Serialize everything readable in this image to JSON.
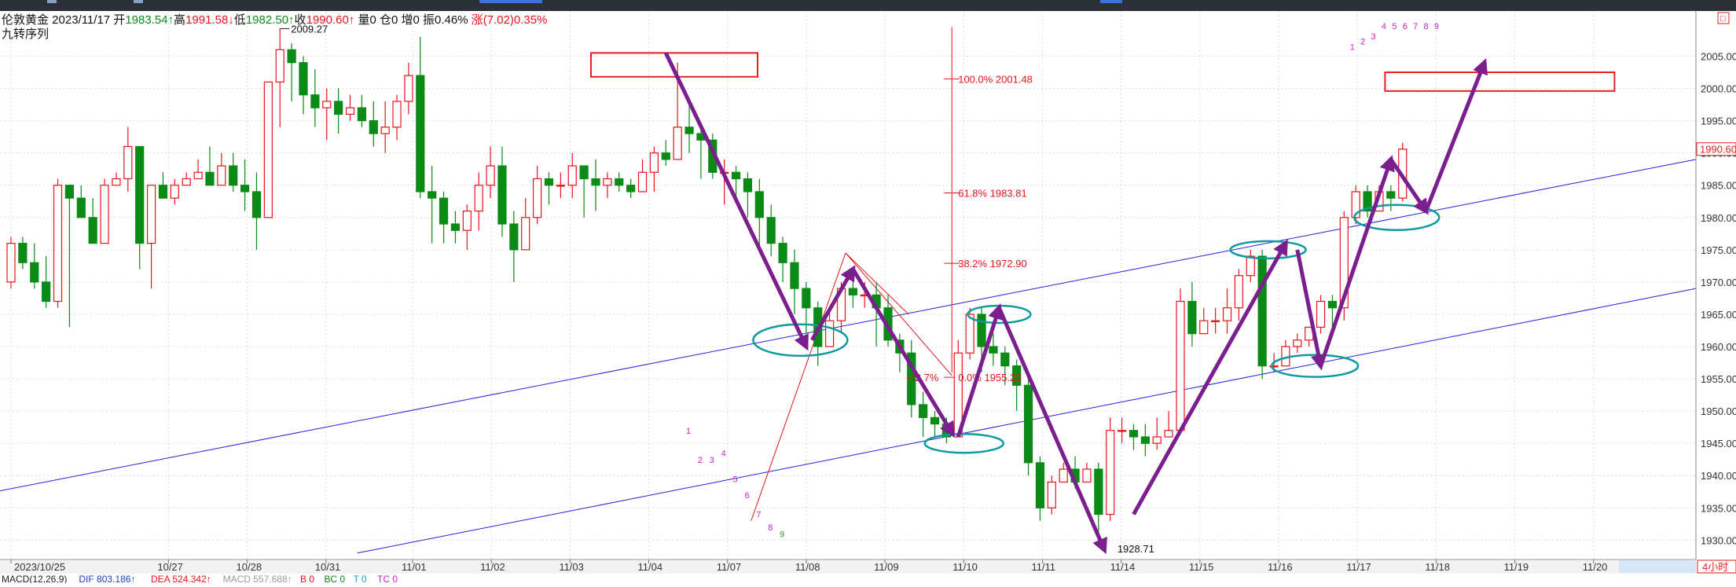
{
  "header": {
    "symbol": "伦敦黄金",
    "date": "2023/11/17",
    "open_label": "开",
    "open": "1983.54",
    "high_label": "高",
    "high": "1991.58",
    "low_label": "低",
    "low": "1982.50",
    "close_label": "收",
    "close": "1990.60",
    "volume": "量0",
    "position": "仓0",
    "increase": "增0",
    "amplitude": "振0.46%",
    "change": "涨(7.02)0.35%",
    "indicator_name": "九转序列"
  },
  "timeframe": "4小时",
  "corner_button": "□",
  "macd_bar": {
    "name": "MACD(12,26,9)",
    "dif": "DIF 803.186↑",
    "dea": "DEA 524.342↑",
    "macd": "MACD 557.688↑",
    "b": "B 0",
    "bc": "BC 0",
    "t": "T 0",
    "tc": "TC 0"
  },
  "colors": {
    "up": "#e8141c",
    "down": "#0b8a16",
    "channel": "#2222dd",
    "arrow": "#7b1f8f",
    "ellipse": "#0d9aa0",
    "box": "#e62020",
    "seq": "#cc22cc",
    "seq_green": "#22aa22"
  },
  "chart_data": {
    "type": "candlestick",
    "ylim": [
      1927,
      2012
    ],
    "y_ticks": [
      "1930.00",
      "1935.00",
      "1940.00",
      "1945.00",
      "1950.00",
      "1955.00",
      "1960.00",
      "1965.00",
      "1970.00",
      "1975.00",
      "1980.00",
      "1985.00",
      "1990.00",
      "1995.00",
      "2000.00",
      "2005.00"
    ],
    "last_price": "1990.60",
    "x_count": 214,
    "x_labels": [
      {
        "i": 0,
        "t": "2023/10/25"
      },
      {
        "i": 20,
        "t": "10/27"
      },
      {
        "i": 30,
        "t": "10/28"
      },
      {
        "i": 40,
        "t": "10/31"
      },
      {
        "i": 51,
        "t": "11/01"
      },
      {
        "i": 61,
        "t": "11/02"
      },
      {
        "i": 71,
        "t": "11/03"
      },
      {
        "i": 81,
        "t": "11/04"
      },
      {
        "i": 91,
        "t": "11/07"
      },
      {
        "i": 101,
        "t": "11/08"
      },
      {
        "i": 111,
        "t": "11/09"
      },
      {
        "i": 121,
        "t": "11/10"
      },
      {
        "i": 131,
        "t": "11/11"
      },
      {
        "i": 141,
        "t": "11/14"
      },
      {
        "i": 151,
        "t": "11/15"
      },
      {
        "i": 161,
        "t": "11/16"
      },
      {
        "i": 171,
        "t": "11/17"
      },
      {
        "i": 181,
        "t": "11/18"
      },
      {
        "i": 191,
        "t": "11/19"
      },
      {
        "i": 201,
        "t": "11/20"
      }
    ],
    "candles": [
      [
        0,
        1970,
        1976,
        1969,
        1977
      ],
      [
        1,
        1976,
        1973,
        1972,
        1977
      ],
      [
        2,
        1973,
        1970,
        1969,
        1976
      ],
      [
        3,
        1970,
        1967,
        1966,
        1974
      ],
      [
        4,
        1967,
        1985,
        1966,
        1986
      ],
      [
        5,
        1985,
        1983,
        1963,
        1985
      ],
      [
        6,
        1983,
        1980,
        1980,
        1985
      ],
      [
        7,
        1980,
        1976,
        1976,
        1983
      ],
      [
        8,
        1976,
        1985,
        1976,
        1986
      ],
      [
        9,
        1985,
        1986,
        1985,
        1987
      ],
      [
        10,
        1986,
        1991,
        1984,
        1994
      ],
      [
        11,
        1991,
        1976,
        1972,
        1991
      ],
      [
        12,
        1976,
        1985,
        1969,
        1985
      ],
      [
        13,
        1985,
        1983,
        1983,
        1987
      ],
      [
        14,
        1983,
        1985,
        1982,
        1986
      ],
      [
        15,
        1985,
        1986,
        1985,
        1987
      ],
      [
        16,
        1986,
        1987,
        1986,
        1989
      ],
      [
        17,
        1987,
        1985,
        1985,
        1991
      ],
      [
        18,
        1985,
        1988,
        1985,
        1990
      ],
      [
        19,
        1988,
        1985,
        1984,
        1990
      ],
      [
        20,
        1985,
        1984,
        1981,
        1989
      ],
      [
        21,
        1984,
        1980,
        1975,
        1987
      ],
      [
        22,
        1980,
        2001,
        1980,
        2001
      ],
      [
        23,
        2001,
        2006,
        1994,
        2009.27
      ],
      [
        24,
        2006,
        2004,
        1998,
        2007
      ],
      [
        25,
        2004,
        1999,
        1996,
        2005
      ],
      [
        26,
        1999,
        1997,
        1994,
        2003
      ],
      [
        27,
        1997,
        1998,
        1992,
        2000
      ],
      [
        28,
        1998,
        1996,
        1993,
        2000
      ],
      [
        29,
        1996,
        1997,
        1995,
        1999
      ],
      [
        30,
        1997,
        1995,
        1994,
        1999
      ],
      [
        31,
        1995,
        1993,
        1991,
        1998
      ],
      [
        32,
        1993,
        1994,
        1990,
        1998
      ],
      [
        33,
        1994,
        1998,
        1992,
        1999
      ],
      [
        34,
        1998,
        2002,
        1996,
        2004
      ],
      [
        35,
        2002,
        1984,
        1983,
        2008
      ],
      [
        36,
        1984,
        1983,
        1976,
        1988
      ],
      [
        37,
        1983,
        1979,
        1976,
        1984
      ],
      [
        38,
        1979,
        1978,
        1976,
        1981
      ],
      [
        39,
        1978,
        1981,
        1975,
        1982
      ],
      [
        40,
        1981,
        1985,
        1978,
        1987
      ],
      [
        41,
        1985,
        1988,
        1983,
        1991
      ],
      [
        42,
        1988,
        1979,
        1977,
        1991
      ],
      [
        43,
        1979,
        1975,
        1970,
        1981
      ],
      [
        44,
        1975,
        1980,
        1975,
        1983
      ],
      [
        45,
        1980,
        1986,
        1979,
        1988
      ],
      [
        46,
        1986,
        1985,
        1982,
        1987
      ],
      [
        47,
        1985,
        1985,
        1983,
        1987
      ],
      [
        48,
        1985,
        1988,
        1983,
        1990
      ],
      [
        49,
        1988,
        1986,
        1980,
        1988
      ],
      [
        50,
        1986,
        1985,
        1981,
        1989
      ],
      [
        51,
        1985,
        1986,
        1983,
        1987
      ],
      [
        52,
        1986,
        1985,
        1984,
        1987
      ],
      [
        53,
        1985,
        1984,
        1983,
        1986
      ],
      [
        54,
        1984,
        1987,
        1985,
        1989
      ],
      [
        55,
        1987,
        1990,
        1984,
        1991
      ],
      [
        56,
        1990,
        1989,
        1988,
        1992
      ],
      [
        57,
        1989,
        1994,
        1989,
        2004
      ],
      [
        58,
        1994,
        1993,
        1990,
        1998
      ],
      [
        59,
        1993,
        1992,
        1986,
        1994
      ],
      [
        60,
        1992,
        1987,
        1986,
        1993
      ],
      [
        61,
        1987,
        1987,
        1982,
        1989
      ],
      [
        62,
        1987,
        1986,
        1983,
        1988
      ],
      [
        63,
        1986,
        1984,
        1980,
        1987
      ],
      [
        64,
        1984,
        1980,
        1975,
        1986
      ],
      [
        65,
        1980,
        1976,
        1974,
        1982
      ],
      [
        66,
        1976,
        1973,
        1970,
        1977
      ],
      [
        67,
        1973,
        1969,
        1965,
        1975
      ],
      [
        68,
        1969,
        1966,
        1962,
        1970
      ],
      [
        69,
        1966,
        1960,
        1957,
        1967
      ],
      [
        70,
        1960,
        1964,
        1960,
        1966
      ],
      [
        71,
        1964,
        1969,
        1962,
        1970
      ],
      [
        72,
        1969,
        1968,
        1966,
        1970
      ],
      [
        73,
        1968,
        1968,
        1966,
        1970
      ],
      [
        74,
        1968,
        1966,
        1960,
        1970
      ],
      [
        75,
        1966,
        1961,
        1960,
        1968
      ],
      [
        76,
        1961,
        1959,
        1956,
        1962
      ],
      [
        77,
        1959,
        1951,
        1949,
        1961
      ],
      [
        78,
        1951,
        1949,
        1946,
        1953
      ],
      [
        79,
        1949,
        1948,
        1946,
        1950
      ],
      [
        80,
        1948,
        1946,
        1945,
        1949
      ],
      [
        81,
        1946,
        1959,
        1946,
        1961
      ],
      [
        82,
        1959,
        1965,
        1958,
        1966
      ],
      [
        83,
        1965,
        1960,
        1956,
        1966
      ],
      [
        84,
        1960,
        1959,
        1957,
        1962
      ],
      [
        85,
        1959,
        1957,
        1954,
        1960
      ],
      [
        86,
        1957,
        1954,
        1950,
        1958
      ],
      [
        87,
        1954,
        1942,
        1940,
        1955
      ],
      [
        88,
        1942,
        1935,
        1933,
        1943
      ],
      [
        89,
        1935,
        1939,
        1934,
        1940
      ],
      [
        90,
        1939,
        1941,
        1939,
        1942
      ],
      [
        91,
        1941,
        1939,
        1938,
        1943
      ],
      [
        92,
        1939,
        1941,
        1940,
        1942
      ],
      [
        93,
        1941,
        1934,
        1931,
        1942
      ],
      [
        94,
        1934,
        1947,
        1933,
        1949
      ],
      [
        95,
        1947,
        1947,
        1945,
        1949
      ],
      [
        96,
        1947,
        1946,
        1944,
        1948
      ],
      [
        97,
        1946,
        1945,
        1943,
        1948
      ],
      [
        98,
        1945,
        1946,
        1944,
        1949
      ],
      [
        99,
        1946,
        1947,
        1946,
        1950
      ],
      [
        100,
        1947,
        1967,
        1947,
        1969
      ],
      [
        101,
        1967,
        1962,
        1960,
        1970
      ],
      [
        102,
        1962,
        1964,
        1962,
        1966
      ],
      [
        103,
        1964,
        1964,
        1962,
        1966
      ],
      [
        104,
        1964,
        1966,
        1962,
        1969
      ],
      [
        105,
        1966,
        1971,
        1964,
        1972
      ],
      [
        106,
        1971,
        1974,
        1970,
        1975
      ],
      [
        107,
        1974,
        1957,
        1955,
        1975
      ],
      [
        108,
        1957,
        1957,
        1956,
        1959
      ],
      [
        109,
        1957,
        1960,
        1957,
        1961
      ],
      [
        110,
        1960,
        1961,
        1959,
        1962
      ],
      [
        111,
        1961,
        1963,
        1960,
        1963
      ],
      [
        112,
        1963,
        1967,
        1962,
        1968
      ],
      [
        113,
        1967,
        1966,
        1963,
        1968
      ],
      [
        114,
        1966,
        1980,
        1964,
        1981
      ],
      [
        115,
        1980,
        1984,
        1979,
        1985
      ],
      [
        116,
        1984,
        1981,
        1980,
        1985
      ],
      [
        117,
        1981,
        1984,
        1981,
        1985
      ],
      [
        118,
        1984,
        1983,
        1981,
        1985
      ],
      [
        119,
        1983,
        1990.6,
        1982.5,
        1991.58
      ]
    ],
    "annotations": {
      "high_label": "2009.27",
      "low_label": "1928.71",
      "fib": [
        "100.0% 2001.48",
        "61.8% 1983.81",
        "38.2% 1972.90",
        "0.0% 1955.23",
        "-42.7%"
      ],
      "seq_top": [
        "1",
        "2",
        "3",
        "4",
        "5",
        "6",
        "7",
        "8",
        "9"
      ],
      "seq_bottom": [
        "1",
        "2",
        "3",
        "4",
        "5",
        "6",
        "7",
        "8",
        "9"
      ]
    }
  }
}
